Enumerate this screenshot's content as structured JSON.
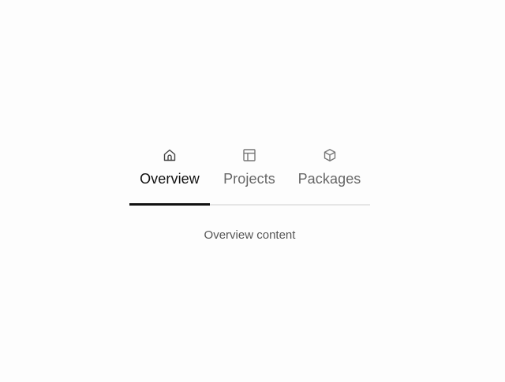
{
  "tabs": [
    {
      "label": "Overview",
      "icon": "home-icon",
      "active": true
    },
    {
      "label": "Projects",
      "icon": "layout-icon",
      "active": false
    },
    {
      "label": "Packages",
      "icon": "box-icon",
      "active": false
    }
  ],
  "panel": {
    "content": "Overview content"
  },
  "colors": {
    "active_text": "#111111",
    "inactive_text": "#666666",
    "indicator": "#111111",
    "divider": "#e6e6e6"
  }
}
